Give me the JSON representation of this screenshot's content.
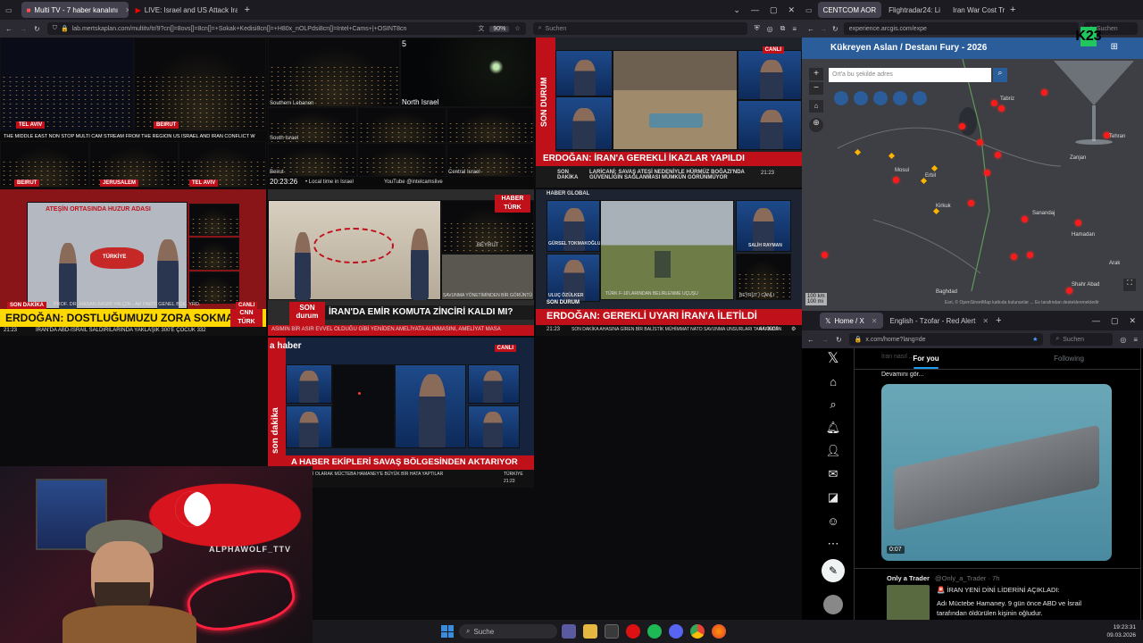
{
  "left_browser": {
    "tabs": [
      {
        "label": "Multi TV - 7 haber kanalını",
        "active": true
      },
      {
        "label": "LIVE: Israel and US Attack Iran -",
        "active": false
      }
    ],
    "url": "lab.mertskaplan.com/multitv/tr/9?cn[]=8ovs[]=8cn[]=+Sokak+Kedisi8cn[]=+H80x_nOLPdsi8cn[]=Intel+Cams+|+OSINT8cn",
    "zoom": "90%",
    "search_placeholder": "Suchen"
  },
  "cam_grid": {
    "labels": [
      "TEL AVIV",
      "BEIRUT",
      "BEIRUT",
      "JERUSALEM",
      "TEL AVIV"
    ],
    "ticker": "THE MIDDLE EAST NON STOP MULTI CAM STREAM FROM THE REGION US ISRAEL AND IRAN CONFLICT W",
    "north_israel": "North Israel",
    "southern_lebanon": "Southern Lebanon",
    "south_israel": "South Israel",
    "beirut": "Beirut",
    "central_israel": "Central Israel",
    "time": "20:23:26",
    "local_time_label": "• Local time in Israel",
    "channel": "YouTube @intelcamslive",
    "number": "5"
  },
  "news1": {
    "side_label": "SON DURUM",
    "headline": "ERDOĞAN: İRAN'A GEREKLİ İKAZLAR YAPILDI",
    "sub": "LARİCANİ: SAVAŞ ATEŞİ NEDENİYLE HÜRMÜZ BOĞAZI'NDA GÜVENLİĞİN SAĞLANMASI MÜMKÜN GÖRÜNMÜYOR",
    "badge": "SON DAKİKA",
    "time": "21:23",
    "live": "CANLI"
  },
  "news2": {
    "map_title": "ATEŞİN ORTASINDA HUZUR ADASI",
    "country": "TÜRKİYE",
    "caption": "PROF. DR. HASAN BASRİ YALÇIN - AK PARTİ GENEL BŞK. YRD.",
    "headline": "ERDOĞAN: DOSTLUĞUMUZU ZORA SOKMAYIN",
    "ticker": "İRAN'DA ABD-İSRAİL SALDIRILARINDA YAKLAŞIK 300'E ÇOCUK 332",
    "badge": "SON DAKİKA",
    "time": "21:23",
    "logo": "CNN TÜRK",
    "live": "CANLI"
  },
  "news3": {
    "logo": "HABER TÜRK",
    "headline": "İRAN'DA EMİR KOMUTA ZİNCİRİ KALDI MI?",
    "ticker": "ASIMIN BİR ASIR EVVEL OLDUĞU GİBİ YENİDEN AMELİYATA ALINMASINI, AMELİYAT MASA",
    "side": "SON durum",
    "time": "21:23",
    "beyrut": "BEYRUT",
    "caption": "SAVUNMA YÖNETİMİNDEN BİR GÖRÜNTÜ"
  },
  "news4": {
    "logo": "HABER GLOBAL",
    "guest1": "GÜRSEL TOKMAKOĞLU",
    "guest2": "ULUÇ ÖZÜLKER",
    "guest3": "SALİH RAYMAN",
    "caption": "TÜRK F-16'LARINDAN BELİRLENME UÇUŞU",
    "beyrut": "BEYRUT / CANLI",
    "label": "SON DURUM",
    "headline": "ERDOĞAN: GEREKLİ UYARI İRAN'A İLETİLDİ",
    "ticker": "SON DAKİKA AHASINA GİREN BİR BALİSTİK MÜHİMMAT NATO SAVUNMA UNSURLARI TARAFINDAN",
    "time": "21:23",
    "price": "44.0000"
  },
  "news5": {
    "logo": "a haber",
    "side": "son dakika",
    "headline": "A HABER EKİPLERİ SAVAŞ BÖLGESİNDEN AKTARIYOR",
    "ticker": "İRAN LİDERİ OLARAK MÜCTEBA HAMANEY'E BÜYÜK BİR HATA YAPTILAR",
    "logo_right": "TÜRKİYE",
    "time": "21:23",
    "live": "CANLI"
  },
  "streamer": {
    "handle": "ALPHAWOLF_TTV"
  },
  "map_browser": {
    "tabs": [
      {
        "label": "CENTCOM AOR",
        "active": true
      },
      {
        "label": "Flightradar24: Li",
        "active": false
      },
      {
        "label": "Iran War Cost Tr",
        "active": false
      }
    ],
    "url": "experience.arcgis.com/expe",
    "search_placeholder": "Suchen",
    "title": "Kükreyen Aslan / Destanı Fury - 2026",
    "address_placeholder": "Ort'a bu şekilde adres",
    "places": [
      "Tabriz",
      "Mosul",
      "Erbil",
      "Kirkuk",
      "Sanandaj",
      "Hamadan",
      "Arak",
      "Baghdad",
      "Tehran",
      "Zanjan",
      "Shahr Abad"
    ],
    "scale1": "100 km",
    "scale2": "100 mi",
    "attribution": "Esri, © OpenStreetMap katkıda bulunanlar ... Es tarafından desteklenmektedir",
    "overlay_logo": "K23"
  },
  "x_browser": {
    "tabs": [
      {
        "label": "Home / X",
        "active": true
      },
      {
        "label": "English - Tzofar - Red Alert",
        "active": false
      }
    ],
    "url": "x.com/home?lang=de",
    "search_placeholder": "Suchen",
    "feed_tabs": [
      "For you",
      "Following"
    ],
    "faded_text": "İran nasıl ...",
    "show_more": "Devamını gör...",
    "video_time": "0:07",
    "post": {
      "author": "Only a Trader",
      "handle": "@Only_a_Trader · 7h",
      "line1": "🚨 İRAN YENİ DİNİ LİDERİNİ AÇIKLADI:",
      "line2": "Adı Müctebe Hamaney. 9 gün önce ABD ve İsrail",
      "line3": "tarafından öldürülen kişinin oğludur."
    }
  },
  "taskbar": {
    "search_placeholder": "Suche",
    "time": "19:23:31",
    "date": "09.03.2026"
  }
}
